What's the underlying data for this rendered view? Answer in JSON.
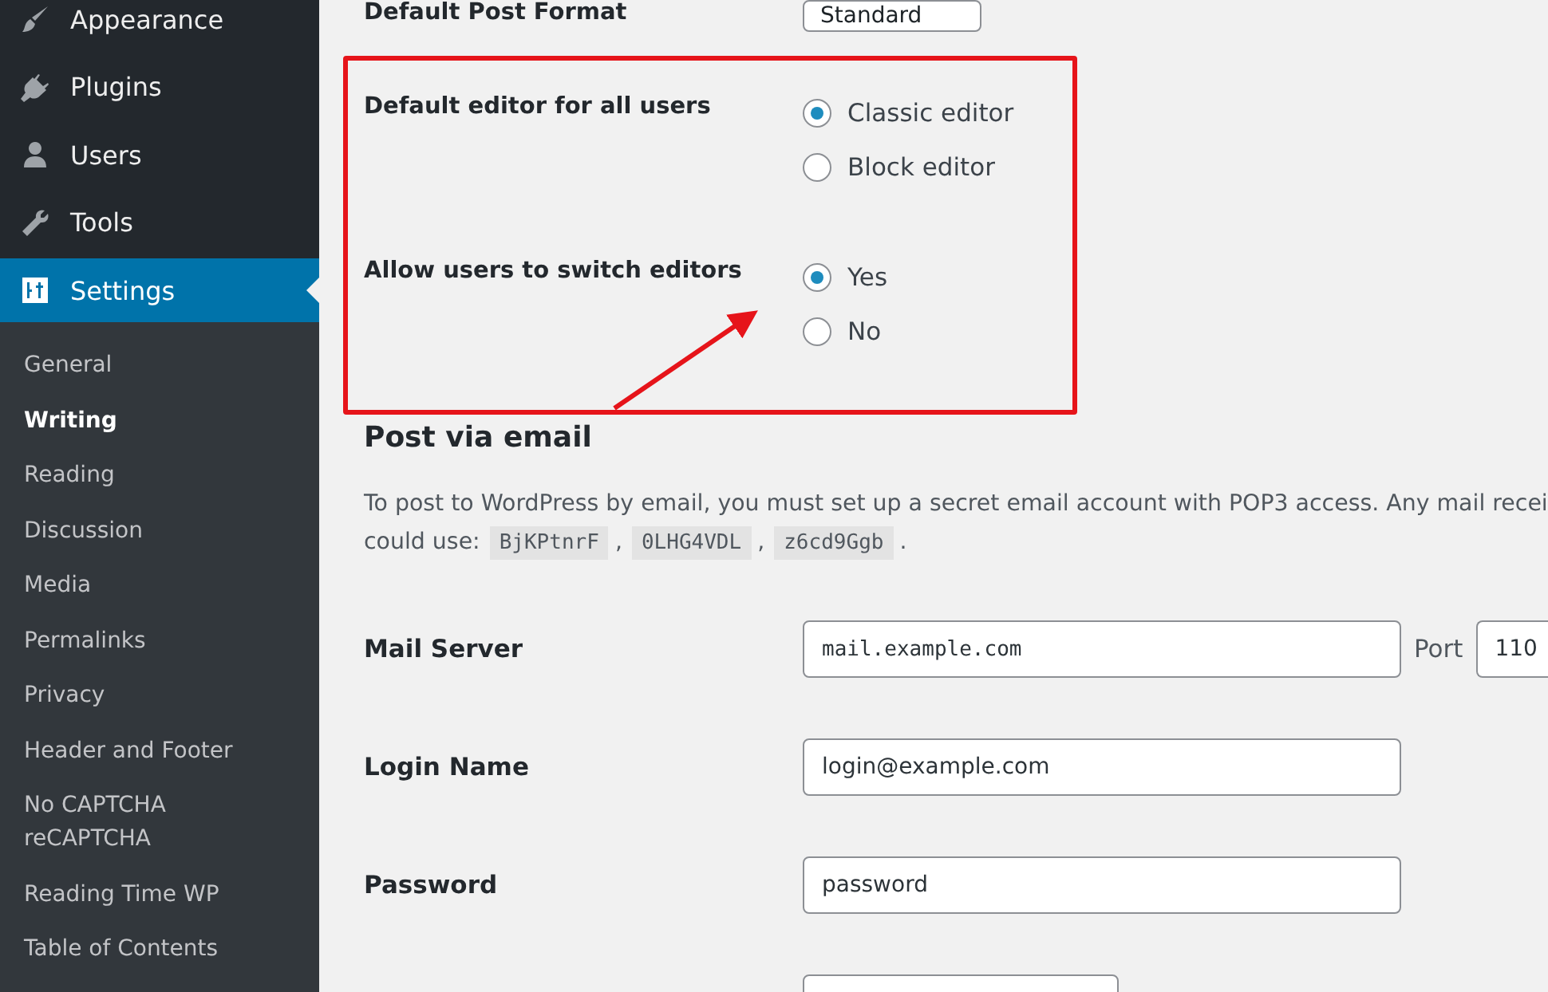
{
  "sidebar": {
    "menu": [
      {
        "label": "Appearance",
        "selected": false
      },
      {
        "label": "Plugins",
        "selected": false
      },
      {
        "label": "Users",
        "selected": false
      },
      {
        "label": "Tools",
        "selected": false
      },
      {
        "label": "Settings",
        "selected": true
      }
    ],
    "submenu": [
      {
        "label": "General",
        "selected": false
      },
      {
        "label": "Writing",
        "selected": true
      },
      {
        "label": "Reading",
        "selected": false
      },
      {
        "label": "Discussion",
        "selected": false
      },
      {
        "label": "Media",
        "selected": false
      },
      {
        "label": "Permalinks",
        "selected": false
      },
      {
        "label": "Privacy",
        "selected": false
      },
      {
        "label": "Header and Footer",
        "selected": false
      },
      {
        "label": "No CAPTCHA reCAPTCHA",
        "selected": false
      },
      {
        "label": "Reading Time WP",
        "selected": false
      },
      {
        "label": "Table of Contents",
        "selected": false
      }
    ]
  },
  "default_post_format": {
    "label": "Default Post Format",
    "value": "Standard"
  },
  "radio_groups": [
    {
      "label": "Default editor for all users",
      "options": [
        {
          "label": "Classic editor",
          "selected": true
        },
        {
          "label": "Block editor",
          "selected": false
        }
      ]
    },
    {
      "label": "Allow users to switch editors",
      "options": [
        {
          "label": "Yes",
          "selected": true
        },
        {
          "label": "No",
          "selected": false
        }
      ]
    }
  ],
  "post_via_email": {
    "heading": "Post via email",
    "text_line_1": "To post to WordPress by email, you must set up a secret email account with POP3 access. Any mail recei",
    "text_line_2": "could use:",
    "codes": [
      {
        "code": "BjKPtnrF",
        "after": ","
      },
      {
        "code": "0LHG4VDL",
        "after": ","
      },
      {
        "code": "z6cd9Ggb",
        "after": "."
      }
    ],
    "fields": [
      {
        "kind": "mono",
        "label": "Mail Server",
        "value": "mail.example.com",
        "port_label": "Port",
        "port_value": "110"
      },
      {
        "kind": "text",
        "label": "Login Name",
        "value": "login@example.com"
      },
      {
        "kind": "text",
        "label": "Password",
        "value": "password"
      },
      {
        "kind": "short"
      }
    ]
  }
}
